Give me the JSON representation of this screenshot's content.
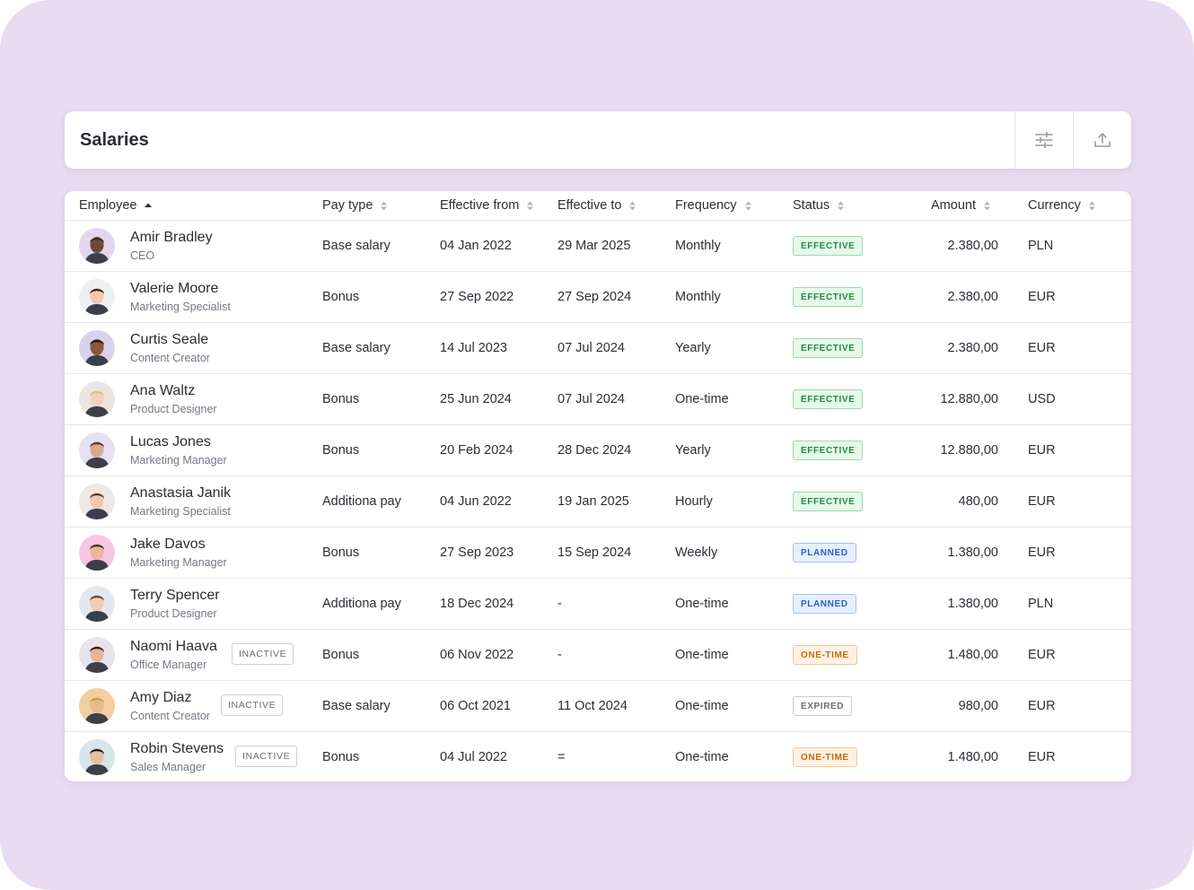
{
  "header": {
    "title": "Salaries",
    "filter_icon": "sliders-icon",
    "export_icon": "upload-icon"
  },
  "columns": [
    "Employee",
    "Pay type",
    "Effective from",
    "Effective to",
    "Frequency",
    "Status",
    "Amount",
    "Currency"
  ],
  "rows": [
    {
      "name": "Amir Bradley",
      "role": "CEO",
      "inactive": "",
      "pay_type": "Base salary",
      "from": "04 Jan 2022",
      "to": "29 Mar 2025",
      "frequency": "Monthly",
      "status": "EFFECTIVE",
      "amount": "2.380,00",
      "currency": "PLN"
    },
    {
      "name": "Valerie Moore",
      "role": "Marketing Specialist",
      "inactive": "",
      "pay_type": "Bonus",
      "from": "27 Sep 2022",
      "to": "27 Sep 2024",
      "frequency": "Monthly",
      "status": "EFFECTIVE",
      "amount": "2.380,00",
      "currency": "EUR"
    },
    {
      "name": "Curtis Seale",
      "role": "Content Creator",
      "inactive": "",
      "pay_type": "Base salary",
      "from": "14 Jul 2023",
      "to": "07 Jul 2024",
      "frequency": "Yearly",
      "status": "EFFECTIVE",
      "amount": "2.380,00",
      "currency": "EUR"
    },
    {
      "name": "Ana Waltz",
      "role": "Product Designer",
      "inactive": "",
      "pay_type": "Bonus",
      "from": "25 Jun 2024",
      "to": "07 Jul 2024",
      "frequency": "One-time",
      "status": "EFFECTIVE",
      "amount": "12.880,00",
      "currency": "USD"
    },
    {
      "name": "Lucas Jones",
      "role": "Marketing Manager",
      "inactive": "",
      "pay_type": "Bonus",
      "from": "20 Feb 2024",
      "to": "28 Dec 2024",
      "frequency": "Yearly",
      "status": "EFFECTIVE",
      "amount": "12.880,00",
      "currency": "EUR"
    },
    {
      "name": "Anastasia Janik",
      "role": "Marketing Specialist",
      "inactive": "",
      "pay_type": "Additiona pay",
      "from": "04 Jun 2022",
      "to": "19 Jan 2025",
      "frequency": "Hourly",
      "status": "EFFECTIVE",
      "amount": "480,00",
      "currency": "EUR"
    },
    {
      "name": "Jake Davos",
      "role": "Marketing Manager",
      "inactive": "",
      "pay_type": "Bonus",
      "from": "27 Sep 2023",
      "to": "15 Sep 2024",
      "frequency": "Weekly",
      "status": "PLANNED",
      "amount": "1.380,00",
      "currency": "EUR"
    },
    {
      "name": "Terry Spencer",
      "role": "Product Designer",
      "inactive": "",
      "pay_type": "Additiona pay",
      "from": "18 Dec 2024",
      "to": "-",
      "frequency": "One-time",
      "status": "PLANNED",
      "amount": "1.380,00",
      "currency": "PLN"
    },
    {
      "name": "Naomi Haava",
      "role": "Office Manager",
      "inactive": "INACTIVE",
      "pay_type": "Bonus",
      "from": "06 Nov 2022",
      "to": "-",
      "frequency": "One-time",
      "status": "ONE-TIME",
      "amount": "1.480,00",
      "currency": "EUR"
    },
    {
      "name": "Amy Diaz",
      "role": "Content Creator",
      "inactive": "INACTIVE",
      "pay_type": "Base salary",
      "from": "06 Oct 2021",
      "to": "11 Oct 2024",
      "frequency": "One-time",
      "status": "EXPIRED",
      "amount": "980,00",
      "currency": "EUR"
    },
    {
      "name": "Robin Stevens",
      "role": "Sales Manager",
      "inactive": "INACTIVE",
      "pay_type": "Bonus",
      "from": "04 Jul 2022",
      "to": "=",
      "frequency": "One-time",
      "status": "ONE-TIME",
      "amount": "1.480,00",
      "currency": "EUR"
    }
  ],
  "colors": {
    "background": "#e8dcf1",
    "effective": "#1f8d3c",
    "planned": "#2a5fc9",
    "one_time": "#c66b10",
    "expired": "#6b6b76"
  }
}
